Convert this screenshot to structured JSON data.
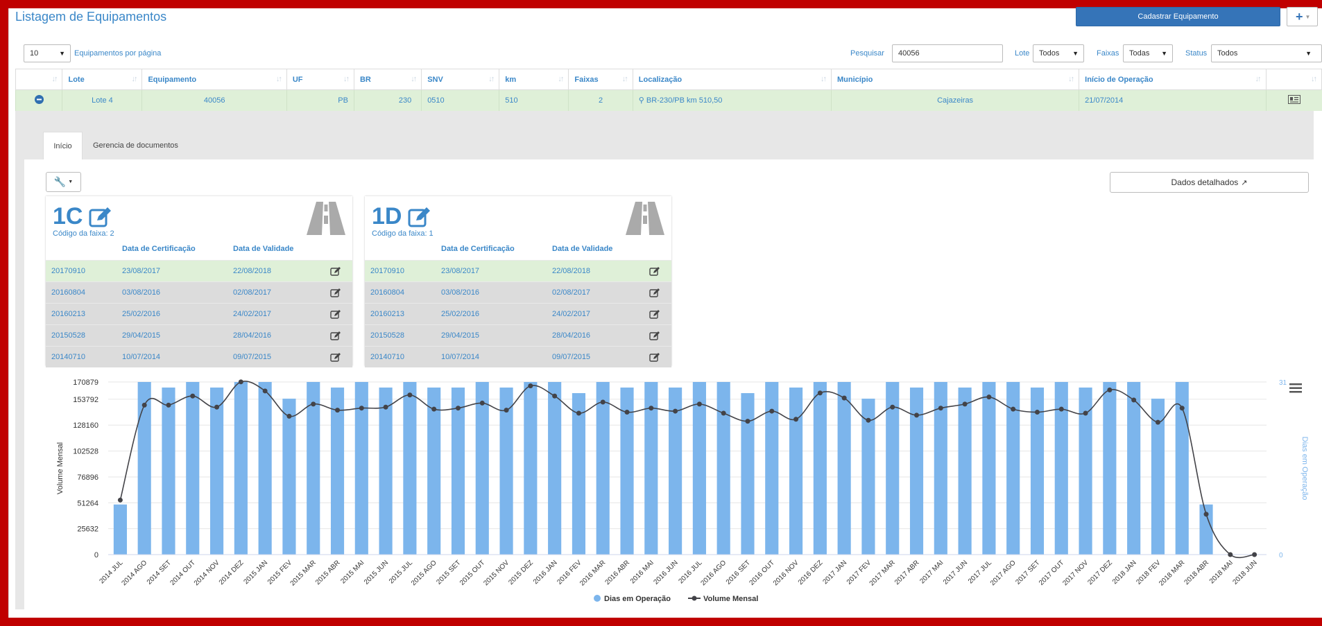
{
  "header": {
    "title": "Listagem de Equipamentos",
    "primary_button": "Cadastrar Equipamento",
    "more_button": "+"
  },
  "filters": {
    "per_page_value": "10",
    "per_page_label": "Equipamentos por página",
    "search_label": "Pesquisar",
    "search_value": "40056",
    "lote_label": "Lote",
    "lote_value": "Todos",
    "faixas_label": "Faixas",
    "faixas_value": "Todas",
    "status_label": "Status",
    "status_value": "Todos"
  },
  "table": {
    "columns": [
      "Lote",
      "Equipamento",
      "UF",
      "BR",
      "SNV",
      "km",
      "Faixas",
      "Localização",
      "Município",
      "Início de Operação"
    ],
    "row": {
      "lote": "Lote 4",
      "equipamento": "40056",
      "uf": "PB",
      "br": "230",
      "snv": "0510",
      "km": "510",
      "faixas": "2",
      "localizacao": "BR-230/PB km 510,50",
      "municipio": "Cajazeiras",
      "inicio": "21/07/2014"
    }
  },
  "tabs": [
    "Início",
    "Gerencia de documentos"
  ],
  "dados_button": "Dados detalhados",
  "cards": [
    {
      "lane": "1C",
      "codigo": "Código da faixa: 2",
      "col_cert": "Data de Certificação",
      "col_valid": "Data de Validade",
      "rows": [
        [
          "20170910",
          "23/08/2017",
          "22/08/2018"
        ],
        [
          "20160804",
          "03/08/2016",
          "02/08/2017"
        ],
        [
          "20160213",
          "25/02/2016",
          "24/02/2017"
        ],
        [
          "20150528",
          "29/04/2015",
          "28/04/2016"
        ],
        [
          "20140710",
          "10/07/2014",
          "09/07/2015"
        ]
      ]
    },
    {
      "lane": "1D",
      "codigo": "Código da faixa: 1",
      "col_cert": "Data de Certificação",
      "col_valid": "Data de Validade",
      "rows": [
        [
          "20170910",
          "23/08/2017",
          "22/08/2018"
        ],
        [
          "20160804",
          "03/08/2016",
          "02/08/2017"
        ],
        [
          "20160213",
          "25/02/2016",
          "24/02/2017"
        ],
        [
          "20150528",
          "29/04/2015",
          "28/04/2016"
        ],
        [
          "20140710",
          "10/07/2014",
          "09/07/2015"
        ]
      ]
    }
  ],
  "colors": {
    "accent": "#3a87c8",
    "bar": "#7cb5ec",
    "line": "#434348",
    "highlight": "#dff0d8",
    "frame": "#c00000"
  },
  "chart_data": {
    "type": "bar",
    "xlabel": "",
    "ylabel": "Volume Mensal",
    "y2label": "Dias em Operação",
    "yticks": [
      0,
      25632,
      51264,
      76896,
      102528,
      128160,
      153792,
      170879
    ],
    "ylim": [
      0,
      170879
    ],
    "y2ticks": [
      0,
      31
    ],
    "y2lim": [
      0,
      31
    ],
    "legend_position": "bottom-center",
    "categories": [
      "2014 JUL",
      "2014 AGO",
      "2014 SET",
      "2014 OUT",
      "2014 NOV",
      "2014 DEZ",
      "2015 JAN",
      "2015 FEV",
      "2015 MAR",
      "2015 ABR",
      "2015 MAI",
      "2015 JUN",
      "2015 JUL",
      "2015 AGO",
      "2015 SET",
      "2015 OUT",
      "2015 NOV",
      "2015 DEZ",
      "2016 JAN",
      "2016 FEV",
      "2016 MAR",
      "2016 ABR",
      "2016 MAI",
      "2016 JUN",
      "2016 JUL",
      "2016 AGO",
      "2016 SET",
      "2016 OUT",
      "2016 NOV",
      "2016 DEZ",
      "2017 JAN",
      "2017 FEV",
      "2017 MAR",
      "2017 ABR",
      "2017 MAI",
      "2017 JUN",
      "2017 JUL",
      "2017 AGO",
      "2017 SET",
      "2017 OUT",
      "2017 NOV",
      "2017 DEZ",
      "2018 JAN",
      "2018 FEV",
      "2018 MAR",
      "2018 ABR",
      "2018 MAI",
      "2018 JUN"
    ],
    "series": [
      {
        "name": "Dias em Operação",
        "axis": "right",
        "type": "bar",
        "values": [
          9,
          31,
          30,
          31,
          30,
          31,
          31,
          28,
          31,
          30,
          31,
          30,
          31,
          30,
          30,
          31,
          30,
          31,
          31,
          29,
          31,
          30,
          31,
          30,
          31,
          31,
          29,
          31,
          30,
          31,
          31,
          28,
          31,
          30,
          31,
          30,
          31,
          31,
          30,
          31,
          30,
          31,
          31,
          28,
          31,
          9,
          0,
          0
        ]
      },
      {
        "name": "Volume Mensal",
        "axis": "left",
        "type": "line",
        "values": [
          54000,
          148000,
          148000,
          157000,
          146000,
          171000,
          162000,
          137000,
          149000,
          143000,
          145000,
          146000,
          158000,
          144000,
          145000,
          150000,
          143000,
          167000,
          157000,
          140000,
          151000,
          141000,
          145000,
          142000,
          149000,
          140000,
          132000,
          142000,
          134000,
          160000,
          155000,
          133000,
          146000,
          138000,
          145000,
          149000,
          156000,
          144000,
          141000,
          144000,
          140000,
          163000,
          153000,
          131000,
          145000,
          40000,
          0,
          0
        ]
      }
    ]
  }
}
